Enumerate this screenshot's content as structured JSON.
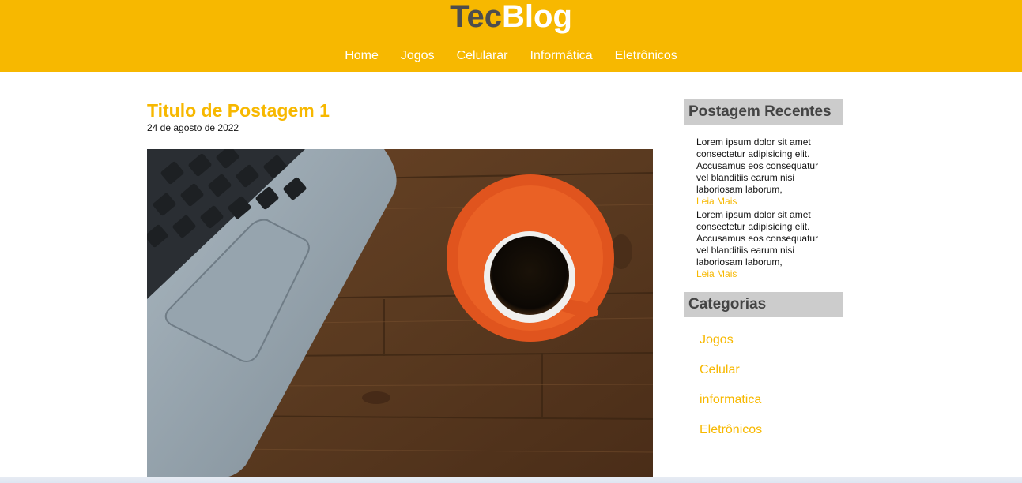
{
  "header": {
    "logo_part1": "Tec",
    "logo_part2": "Blog",
    "nav": [
      "Home",
      "Jogos",
      "Celularar",
      "Informática",
      "Eletrônicos"
    ]
  },
  "post": {
    "title": "Titulo de Postagem 1",
    "date": "24 de agosto de 2022"
  },
  "sidebar": {
    "recent_heading": "Postagem Recentes",
    "recent_posts": [
      {
        "line1": "Lorem ipsum dolor sit amet",
        "line2": "consectetur adipisicing elit.",
        "line3": "Accusamus eos consequatur",
        "line4": "vel blanditiis earum nisi",
        "line5": "laboriosam laborum,",
        "more": "Leia Mais"
      },
      {
        "line1": "Lorem ipsum dolor sit amet",
        "line2": "consectetur adipisicing elit.",
        "line3": "Accusamus eos consequatur",
        "line4": "vel blanditiis earum nisi",
        "line5": "laboriosam laborum,",
        "more": "Leia Mais"
      }
    ],
    "categories_heading": "Categorias",
    "categories": [
      "Jogos",
      "Celular",
      "informatica",
      "Eletrônicos"
    ]
  },
  "colors": {
    "brand_yellow": "#f7b800",
    "logo_dark": "#4d4d4d",
    "sidebar_heading_bg": "#cccccc"
  },
  "icons": {
    "post_image": "laptop-and-coffee-photo"
  }
}
